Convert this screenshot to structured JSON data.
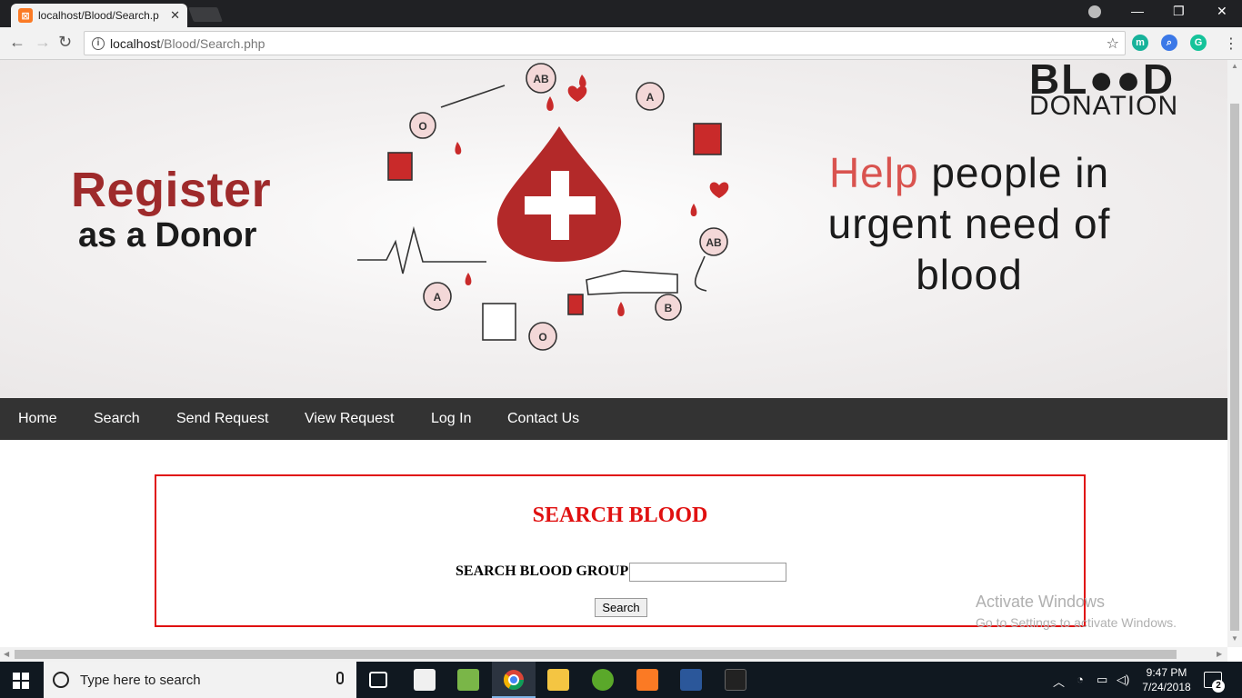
{
  "browser": {
    "tab_title": "localhost/Blood/Search.p",
    "tab_favicon": "xampp-icon",
    "url_host": "localhost",
    "url_path": "/Blood/Search.php"
  },
  "banner": {
    "register_line1": "Register",
    "register_line2": "as a Donor",
    "logo_top": "BL●●D",
    "logo_bottom": "DONATION",
    "tagline_highlight": "Help",
    "tagline_rest_line1": "people in",
    "tagline_line2": "urgent need of",
    "tagline_line3": "blood",
    "art_labels": [
      "AB",
      "A",
      "O",
      "AB",
      "A",
      "O",
      "B"
    ]
  },
  "nav": {
    "items": [
      {
        "label": "Home"
      },
      {
        "label": "Search"
      },
      {
        "label": "Send Request"
      },
      {
        "label": "View Request"
      },
      {
        "label": "Log In"
      },
      {
        "label": "Contact Us"
      }
    ]
  },
  "search_form": {
    "title": "SEARCH BLOOD",
    "label": "SEARCH BLOOD GROUP",
    "input_value": "",
    "button_label": "Search"
  },
  "watermark": {
    "line1": "Activate Windows",
    "line2": "Go to Settings to activate Windows."
  },
  "taskbar": {
    "search_placeholder": "Type here to search",
    "time": "9:47 PM",
    "date": "7/24/2018",
    "notification_count": "2"
  },
  "colors": {
    "accent_red": "#e01010",
    "nav_bg": "#333333",
    "register_red": "#9e2a2b",
    "help_red": "#d9534f"
  }
}
